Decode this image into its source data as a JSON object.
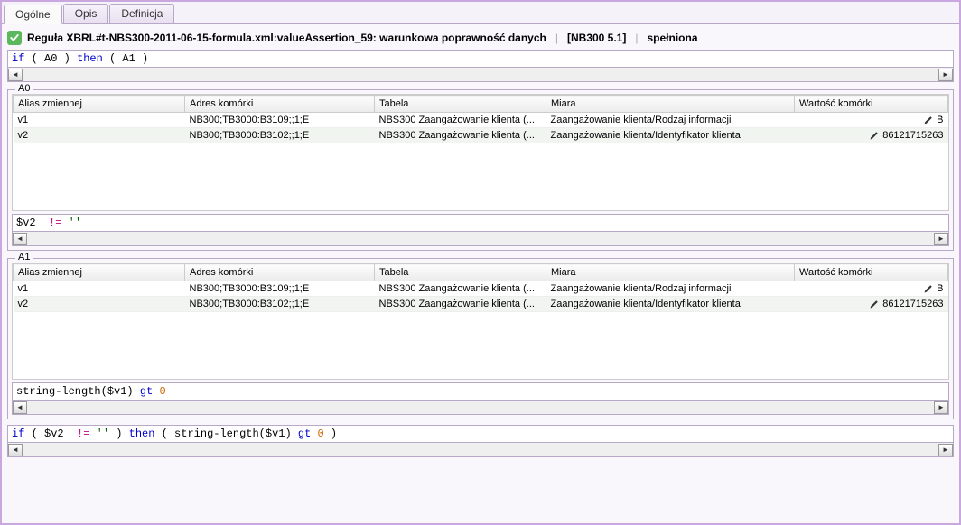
{
  "tabs": {
    "t0": "Ogólne",
    "t1": "Opis",
    "t2": "Definicja"
  },
  "header": {
    "rule": "Reguła XBRL#t-NBS300-2011-06-15-formula.xml:valueAssertion_59: warunkowa poprawność danych",
    "tag": "[NB300 5.1]",
    "status": "spełniona"
  },
  "code_top": "if ( A0 ) then ( A1 )",
  "a0": {
    "legend": "A0",
    "cols": {
      "c0": "Alias zmiennej",
      "c1": "Adres komórki",
      "c2": "Tabela",
      "c3": "Miara",
      "c4": "Wartość komórki"
    },
    "rows": [
      {
        "alias": "v1",
        "addr": "NB300;TB3000:B3109;;1;E",
        "tab": "NBS300 Zaangażowanie klienta (...",
        "miara": "Zaangażowanie klienta/Rodzaj informacji",
        "val": "B",
        "pen": true
      },
      {
        "alias": "v2",
        "addr": "NB300;TB3000:B3102;;1;E",
        "tab": "NBS300 Zaangażowanie klienta (...",
        "miara": "Zaangażowanie klienta/Identyfikator klienta",
        "val": "86121715263",
        "pen": true
      }
    ],
    "expr": "$v2  != ''"
  },
  "a1": {
    "legend": "A1",
    "cols": {
      "c0": "Alias zmiennej",
      "c1": "Adres komórki",
      "c2": "Tabela",
      "c3": "Miara",
      "c4": "Wartość komórki"
    },
    "rows": [
      {
        "alias": "v1",
        "addr": "NB300;TB3000:B3109;;1;E",
        "tab": "NBS300 Zaangażowanie klienta (...",
        "miara": "Zaangażowanie klienta/Rodzaj informacji",
        "val": "B",
        "pen": true
      },
      {
        "alias": "v2",
        "addr": "NB300;TB3000:B3102;;1;E",
        "tab": "NBS300 Zaangażowanie klienta (...",
        "miara": "Zaangażowanie klienta/Identyfikator klienta",
        "val": "86121715263",
        "pen": true
      }
    ],
    "expr": "string-length($v1) gt 0"
  },
  "code_bottom": "if ( $v2  != '' ) then ( string-length($v1) gt 0 )"
}
